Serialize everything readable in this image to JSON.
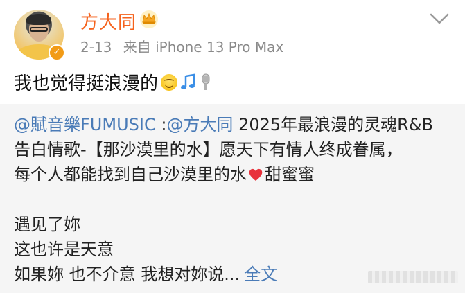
{
  "post": {
    "username": "方大同",
    "date": "2-13",
    "source": "来自 iPhone 13 Pro Max",
    "text": "我也觉得挺浪漫的"
  },
  "icons": {
    "verified": "verified-badge-icon",
    "crown": "crown-icon",
    "menu": "chevron-down-icon",
    "smile": "smile-emoji-icon",
    "music": "music-note-icon",
    "mic": "microphone-icon",
    "heart": "heart-icon"
  },
  "repost": {
    "mention1": "@賦音樂FUMUSIC",
    "sep": " :",
    "mention2": "@方大同",
    "line1_rest": " 2025年最浪漫的灵魂R&B",
    "line2": "告白情歌-【那沙漠里的水】愿天下有情人终成眷属，",
    "line3_a": "每个人都能找到自己沙漠里的水",
    "line3_b": "甜蜜蜜",
    "poem_line1": "遇见了妳",
    "poem_line2": "这也许是天意",
    "poem_line3": "如果妳  也不介意  我想对妳说...",
    "full_text": "全文"
  },
  "colors": {
    "username": "#f5621c",
    "link": "#4a7bb7",
    "repost_bg": "#f5f5f5"
  }
}
